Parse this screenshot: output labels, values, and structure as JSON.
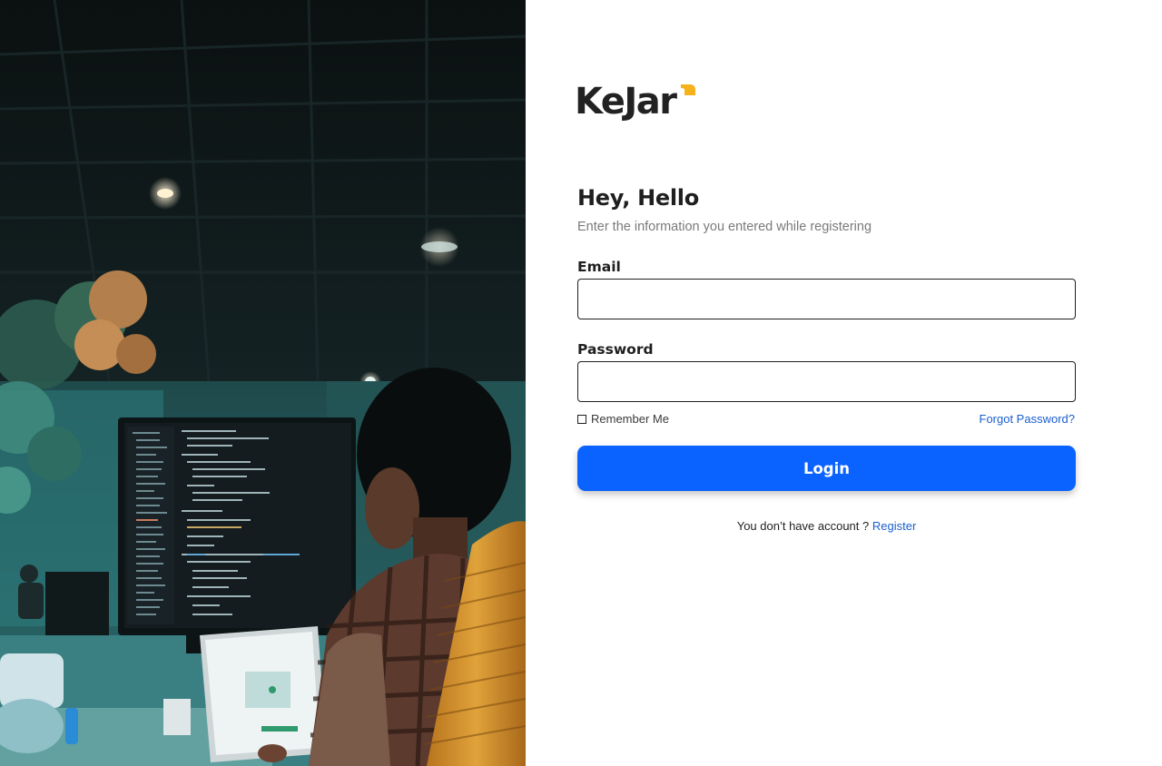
{
  "brand": {
    "logo_text": "KeJar",
    "accent_color": "#f5b21b",
    "text_color": "#222222"
  },
  "hero_image": {
    "icon": "office-developer-photo"
  },
  "form": {
    "title": "Hey, Hello",
    "subtitle": "Enter the information you entered while registering",
    "email": {
      "label": "Email",
      "value": "",
      "placeholder": ""
    },
    "password": {
      "label": "Password",
      "value": "",
      "placeholder": ""
    },
    "remember_me": {
      "label": "Remember Me",
      "checked": false
    },
    "forgot_password": "Forgot Password?",
    "login_button": "Login",
    "register_prompt": "You don’t have account ?",
    "register_link": "Register"
  },
  "colors": {
    "primary_button": "#0a62ff",
    "link": "#1a5fd0"
  }
}
